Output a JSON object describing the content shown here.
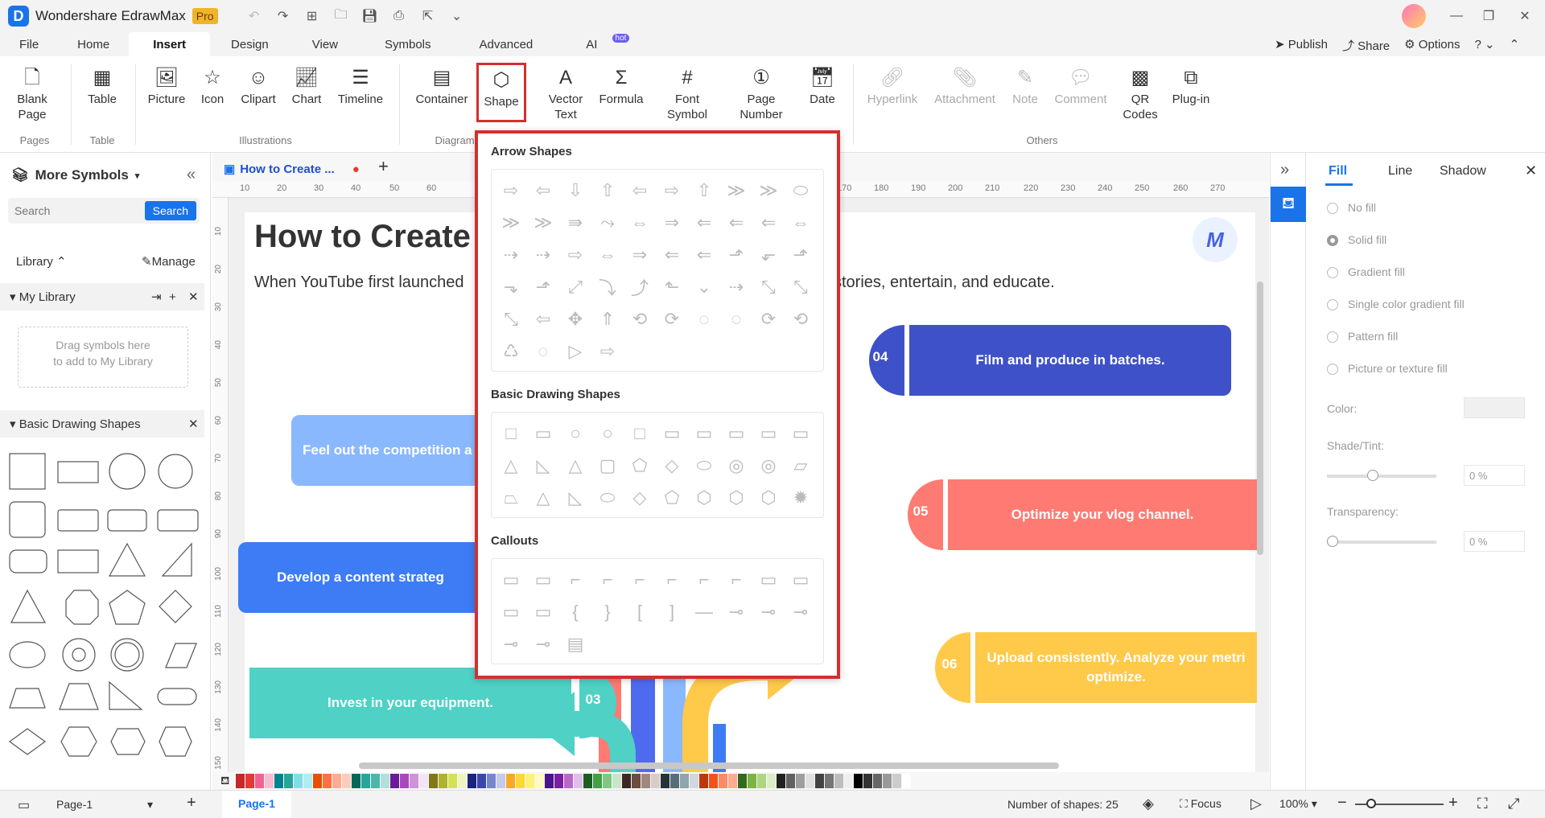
{
  "app": {
    "name": "Wondershare EdrawMax",
    "badge": "Pro",
    "logo": "D"
  },
  "menu": {
    "items": [
      {
        "label": "File"
      },
      {
        "label": "Home"
      },
      {
        "label": "Insert"
      },
      {
        "label": "Design"
      },
      {
        "label": "View"
      },
      {
        "label": "Symbols"
      },
      {
        "label": "Advanced"
      },
      {
        "label": "AI"
      }
    ],
    "hot": "hot",
    "publish": "Publish",
    "share": "Share",
    "options": "Options"
  },
  "ribbon": {
    "blank_page": "Blank\nPage",
    "table": "Table",
    "picture": "Picture",
    "icon": "Icon",
    "clipart": "Clipart",
    "chart": "Chart",
    "timeline": "Timeline",
    "container": "Container",
    "shape": "Shape",
    "vector_text": "Vector\nText",
    "formula": "Formula",
    "font_symbol": "Font\nSymbol",
    "page_number": "Page\nNumber",
    "date": "Date",
    "hyperlink": "Hyperlink",
    "attachment": "Attachment",
    "note": "Note",
    "comment": "Comment",
    "qr_codes": "QR\nCodes",
    "plugin": "Plug-in",
    "groups": {
      "pages": "Pages",
      "table": "Table",
      "illustrations": "Illustrations",
      "diagram": "Diagram",
      "others": "Others"
    }
  },
  "left": {
    "title": "More Symbols",
    "search_placeholder": "Search",
    "search_btn": "Search",
    "library": "Library",
    "manage": "Manage",
    "my_library": "My Library",
    "drag_hint": "Drag symbols here to add to My Library",
    "basic_shapes": "Basic Drawing Shapes"
  },
  "doc": {
    "tab": "How to Create ...",
    "heading": "How to Create",
    "intro_left": "When YouTube first launched",
    "intro_right": "stories, entertain, and educate.",
    "steps": [
      {
        "num": "04",
        "text": "Film and produce in batches."
      },
      {
        "num": "05",
        "text": "Optimize your vlog channel."
      },
      {
        "num": "06",
        "text": "Upload consistently. Analyze your metri optimize."
      },
      {
        "num": "03",
        "text": "Invest in your equipment."
      }
    ],
    "box_competition": "Feel out the competition a",
    "box_strategy": "Develop a content strateg"
  },
  "ruler": {
    "top": [
      "10",
      "20",
      "30",
      "40",
      "50",
      "60",
      "170",
      "180",
      "190",
      "200",
      "210",
      "220",
      "230",
      "240",
      "250",
      "260",
      "270"
    ],
    "left": [
      "10",
      "20",
      "30",
      "40",
      "50",
      "60",
      "70",
      "80",
      "90",
      "100",
      "110",
      "120",
      "130",
      "140",
      "150"
    ]
  },
  "dropdown": {
    "arrow": "Arrow Shapes",
    "basic": "Basic Drawing Shapes",
    "callouts": "Callouts"
  },
  "right": {
    "tabs": {
      "fill": "Fill",
      "line": "Line",
      "shadow": "Shadow"
    },
    "options": [
      "No fill",
      "Solid fill",
      "Gradient fill",
      "Single color gradient fill",
      "Pattern fill",
      "Picture or texture fill"
    ],
    "color": "Color:",
    "shade": "Shade/Tint:",
    "shade_val": "0 %",
    "transparency": "Transparency:",
    "trans_val": "0 %"
  },
  "status": {
    "page": "Page-1",
    "page_tab": "Page-1",
    "shapes": "Number of shapes: 25",
    "focus": "Focus",
    "zoom": "100%"
  },
  "colors": {
    "accent": "#1a73e8",
    "highlight": "#d32f2f",
    "blue_step": "#3f51c8",
    "salmon": "#ff7a72",
    "yellow": "#ffc94a",
    "teal": "#4fd1c5",
    "light_blue": "#8ab8ff",
    "royal": "#3d7cf5"
  }
}
